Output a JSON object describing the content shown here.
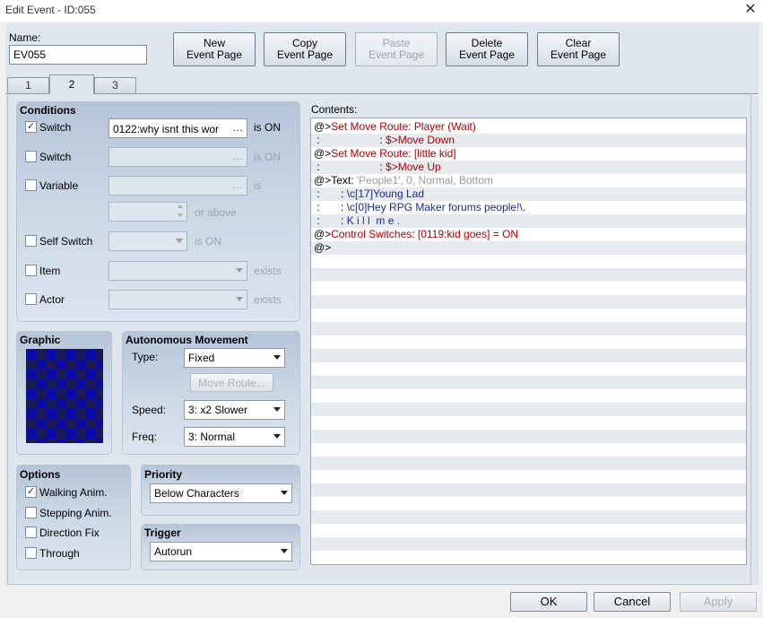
{
  "window": {
    "title": "Edit Event - ID:055"
  },
  "name": {
    "label": "Name:",
    "value": "EV055"
  },
  "toolbar": {
    "new_event_page": "New\nEvent Page",
    "copy_event_page": "Copy\nEvent Page",
    "paste_event_page": "Paste\nEvent Page",
    "delete_event_page": "Delete\nEvent Page",
    "clear_event_page": "Clear\nEvent Page"
  },
  "tabs": [
    {
      "label": "1"
    },
    {
      "label": "2",
      "active": true
    },
    {
      "label": "3"
    }
  ],
  "conditions": {
    "title": "Conditions",
    "switch1": {
      "label": "Switch",
      "checked": true,
      "value": "0122:why isnt this wor",
      "suffix": "is ON"
    },
    "switch2": {
      "label": "Switch",
      "checked": false,
      "value": "",
      "suffix": "is ON"
    },
    "variable": {
      "label": "Variable",
      "checked": false,
      "value": "",
      "suffix": "is",
      "or_above": "or above"
    },
    "self_switch": {
      "label": "Self Switch",
      "checked": false,
      "value": "",
      "suffix": "is ON"
    },
    "item": {
      "label": "Item",
      "checked": false,
      "value": "",
      "suffix": "exists"
    },
    "actor": {
      "label": "Actor",
      "checked": false,
      "value": "",
      "suffix": "exists"
    }
  },
  "graphic": {
    "title": "Graphic"
  },
  "autonomous": {
    "title": "Autonomous Movement",
    "type_label": "Type:",
    "type_value": "Fixed",
    "move_route": "Move Route...",
    "speed_label": "Speed:",
    "speed_value": "3: x2 Slower",
    "freq_label": "Freq:",
    "freq_value": "3: Normal"
  },
  "options": {
    "title": "Options",
    "walking": {
      "label": "Walking Anim.",
      "checked": true
    },
    "stepping": {
      "label": "Stepping Anim.",
      "checked": false
    },
    "direction_fix": {
      "label": "Direction Fix",
      "checked": false
    },
    "through": {
      "label": "Through",
      "checked": false
    }
  },
  "priority": {
    "title": "Priority",
    "value": "Below Characters"
  },
  "trigger": {
    "title": "Trigger",
    "value": "Autorun"
  },
  "contents": {
    "label": "Contents:",
    "lines": [
      [
        {
          "t": "@>",
          "c": ""
        },
        {
          "t": "Set Move Route: Player (Wait)",
          "c": "cmd"
        }
      ],
      [
        {
          "t": " :                    : ",
          "c": ""
        },
        {
          "t": "$>Move Down",
          "c": "cmd"
        }
      ],
      [
        {
          "t": "@>",
          "c": ""
        },
        {
          "t": "Set Move Route: [little kid]",
          "c": "cmd"
        }
      ],
      [
        {
          "t": " :                    : ",
          "c": ""
        },
        {
          "t": "$>Move Up",
          "c": "cmd"
        }
      ],
      [
        {
          "t": "@>",
          "c": ""
        },
        {
          "t": "Text: ",
          "c": ""
        },
        {
          "t": "'People1', 0, Normal, Bottom",
          "c": "dim"
        }
      ],
      [
        {
          "t": " :       : ",
          "c": ""
        },
        {
          "t": "\\c[17]Young Lad",
          "c": "txt"
        }
      ],
      [
        {
          "t": " :       : ",
          "c": ""
        },
        {
          "t": "\\c[0]Hey RPG Maker forums people!\\.",
          "c": "txt"
        }
      ],
      [
        {
          "t": " :       : ",
          "c": ""
        },
        {
          "t": "K i l l  m e .",
          "c": "txt"
        }
      ],
      [
        {
          "t": "@>",
          "c": ""
        },
        {
          "t": "Control Switches: [0119:kid goes] = ON",
          "c": "cmd"
        }
      ],
      [
        {
          "t": "@>",
          "c": ""
        }
      ]
    ]
  },
  "footer": {
    "ok": "OK",
    "cancel": "Cancel",
    "apply": "Apply"
  }
}
